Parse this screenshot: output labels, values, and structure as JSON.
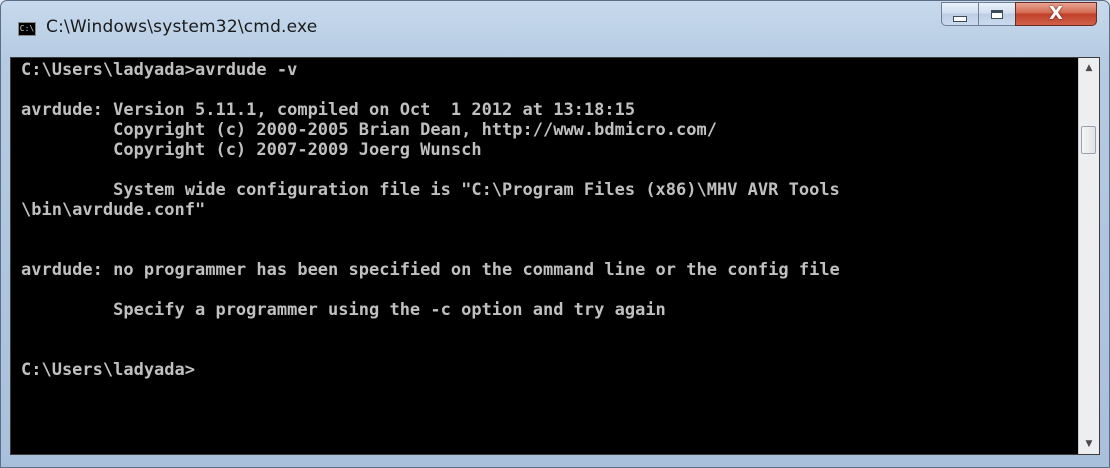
{
  "window": {
    "title": "C:\\Windows\\system32\\cmd.exe",
    "icon": "cmd-icon",
    "icon_text": "C:\\",
    "controls": {
      "minimize_icon": "minimize-icon",
      "maximize_icon": "maximize-icon",
      "close_label": "X"
    }
  },
  "console": {
    "lines": [
      "C:\\Users\\ladyada>avrdude -v",
      "",
      "avrdude: Version 5.11.1, compiled on Oct  1 2012 at 13:18:15",
      "         Copyright (c) 2000-2005 Brian Dean, http://www.bdmicro.com/",
      "         Copyright (c) 2007-2009 Joerg Wunsch",
      "",
      "         System wide configuration file is \"C:\\Program Files (x86)\\MHV AVR Tools",
      "\\bin\\avrdude.conf\"",
      "",
      "",
      "avrdude: no programmer has been specified on the command line or the config file",
      "",
      "         Specify a programmer using the -c option and try again",
      "",
      "",
      "C:\\Users\\ladyada>"
    ]
  },
  "scrollbar": {
    "up_arrow": "▲",
    "down_arrow": "▼"
  },
  "colors": {
    "console_bg": "#000000",
    "console_text": "#c0c0c0",
    "close_button": "#c2402a"
  }
}
